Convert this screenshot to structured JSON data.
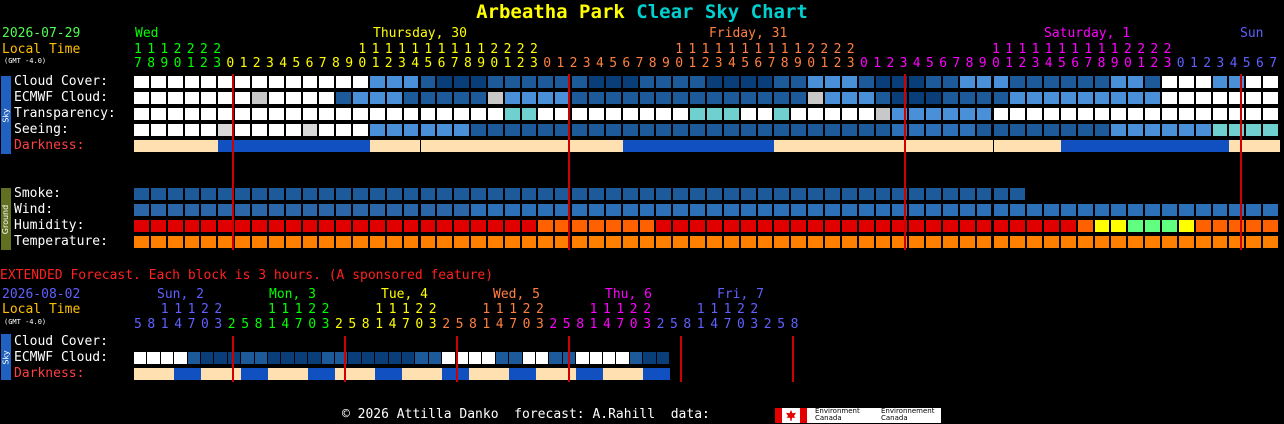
{
  "header": {
    "title_part1": "Arbeatha Park",
    "title_part2": "Clear Sky Chart",
    "date": "2026-07-29",
    "local_time": "Local Time",
    "gmt": "(GMT -4.0)",
    "days": [
      {
        "label": "Wed",
        "color": "#00ff00"
      },
      {
        "label": "Thursday, 30",
        "color": "#ffff00"
      },
      {
        "label": "Friday, 31",
        "color": "#ff8040"
      },
      {
        "label": "Saturday, 1",
        "color": "#ff00ff"
      },
      {
        "label": "Sun",
        "color": "#6060ff"
      }
    ],
    "hours_tens": "1 1 1 2 2 2 2              1 1 1 1 1 1 1 1 1 1 2 2 2 2              1 1 1 1 1 1 1 1 1 1 2 2 2 2              1 1 1 1 1 1 1 1 1 1 2 2 2 2",
    "hours_ones": "7 8 9 0 1 2 3 0 1 2 3 4 5 6 7 8 9 0 1 2 3 4 5 6 7 8 9 0 1 2 3 0 1 2 3 4 5 6 7 8 9 0 1 2 3 4 5 6 7 8 9 0 1 2 3 0 1 2 3 4 5 6 7 8 9 0 1 2 3 4 5 6 7 8 9 0 1 2 3 0 1 2 3 4 5 6 7 8 9 0 1 2 3 4 5 6 7 8 9 0 1 2 3 0 1 2"
  },
  "labels": {
    "sky_group": "Sky",
    "ground_group": "Ground",
    "cloud_cover": "Cloud Cover:",
    "ecmwf_cloud": "ECMWF Cloud:",
    "transparency": "Transparency:",
    "seeing": "Seeing:",
    "darkness": "Darkness:",
    "smoke": "Smoke:",
    "wind": "Wind:",
    "humidity": "Humidity:",
    "temperature": "Temperature:"
  },
  "extended": {
    "notice": "EXTENDED Forecast. Each block is 3 hours. (A sponsored feature)",
    "date": "2026-08-02",
    "local_time": "Local Time",
    "gmt": "(GMT -4.0)",
    "days": [
      {
        "label": "Sun, 2",
        "color": "#6060ff"
      },
      {
        "label": "Mon, 3",
        "color": "#00ff00"
      },
      {
        "label": "Tue, 4",
        "color": "#ffff00"
      },
      {
        "label": "Wed, 5",
        "color": "#ff8040"
      },
      {
        "label": "Thu, 6",
        "color": "#ff00ff"
      },
      {
        "label": "Fri, 7",
        "color": "#6060ff"
      }
    ],
    "hours_tens": "1 1 1 2 2",
    "hours_ones": "5 8 1 4 7 0 3 2"
  },
  "footer": {
    "text": "© 2026 Attilla Danko  forecast: A.Rahill  data:",
    "logo_text_en": "Environment\nCanada",
    "logo_text_fr": "Environnement\nCanada"
  },
  "colors": {
    "label_white": "#ffffff",
    "darkness_label": "#ff4040",
    "date_green": "#50ff50",
    "local_time": "#ffc000",
    "midnight_line": "#d00000",
    "extended_notice": "#ff2020"
  },
  "grid": {
    "hours_main": 86,
    "blocks_extended": 40,
    "cloud_cover": "WWWWWWWWWWWWWWWWWWWWWWWWWWWWWWWWWWWWWWWWWWWWWWWWWWWWWWWWWWWWWWWWWWWWWWWWWWWWWWWWWWWWWWWWWWWWWWWWWWWWWWWWWWWWWWW",
    "legend": "W=clear/white, letters = codes",
    "row_cloud": "wwwwwwwwwwwwwwbbbdeeeddddddeeeddddeeeeddbbbdeeeddbbbddddddbbdwwwbbwwbbbbwwggwwbbbww",
    "row_ecmwf": "wwwwwwwgwwwwdbbbdddddgbbbbddddddddddddddgbbbdeeeddddbbbbbbbbbwwwwwwwwwwwwwwwwcccccccwwwwww",
    "row_transp": "wwwwwwwwwwwwwwwwwwwwwwccwwwwwwwwwcccwwcwwwwwgbbbbbbwwwwwwwwwwwwwwwwwwwwwwwwwwwwwwwwwwwww",
    "row_seeing": "wwwwwkwwwwkwwwbbbbbbdddddddddddddddddddddddddnnnnnddddddddbbbbbbcccccdddddbbbbdddddssssswwwws",
    "row_dark": "yyyyyBBBBBBBBByyyyyyyyyyyyyyyBBBBBBBBByyyyyyyyyyyyyyyyyBBBBBBBBBByyyyyyyyyyyyyyyyyyyyBBBBBBBBB",
    "row_smoke": "dddddddddddddddddddddddddddddddddddddddddddddddddddddddddddddddddddddddddd",
    "row_wind": "mmmmmmmmmmmmmmmmmmmmnnnnnnnnnnnnnnnnnnnnnnnnnnnnnnnnnnnnnnnnnnnnnnnnmmmmmmmmmmmmmmmnnnnnnnnnmmmmn",
    "row_humid": "rrrrrrrrrrrrrrrrrrrrrrrrooooooorrrrrrrrrrrrrrrrrrrrrrrrroyygggyoooooooooooorrrrrrrrrrrrrrrr",
    "row_temp": "ooooooooooooooooooooooooooooooooooooooooooooooooooooooooooooooooooooooooooooooooooooooooooo",
    "ext_cloud": "wwwwdeeeddeeeeddeeeeeddwwwwddwwdd",
    "ext_dark": "yyyBByyyBByyyBByyyBByyyBByyyBByyyBB"
  }
}
